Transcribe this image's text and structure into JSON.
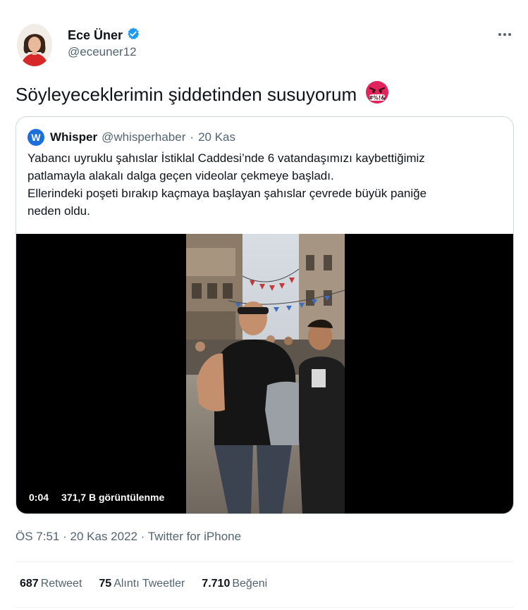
{
  "author": {
    "name": "Ece Üner",
    "handle": "@eceuner12",
    "verified": true
  },
  "tweet": {
    "text": "Söyleyeceklerimin şiddetinden susuyorum",
    "emoji": "#%!&"
  },
  "quoted": {
    "name": "Whisper",
    "handle": "@whisperhaber",
    "separator": "·",
    "date": "20 Kas",
    "logo_letter": "W",
    "body": [
      "Yabancı uyruklu şahıslar İstiklal Caddesi’nde 6 vatandaşımızı kaybettiğimiz",
      "patlamayla alakalı dalga geçen videolar çekmeye başladı.",
      "Ellerindeki poşeti bırakıp kaçmaya başlayan şahıslar çevrede büyük paniğe",
      "neden oldu."
    ],
    "video": {
      "duration": "0:04",
      "views": "371,7 B görüntülenme"
    }
  },
  "meta": {
    "time": "ÖS 7:51",
    "date": "20 Kas 2022",
    "source": "Twitter for iPhone",
    "separator": "·"
  },
  "stats": {
    "retweets": {
      "count": "687",
      "label": "Retweet"
    },
    "quotes": {
      "count": "75",
      "label": "Alıntı Tweetler"
    },
    "likes": {
      "count": "7.710",
      "label": "Beğeni"
    }
  },
  "colors": {
    "verified": "#1d9bf0",
    "secondary_text": "#536471",
    "border": "#cfd9de",
    "angry_emoji": "#e0245e"
  },
  "icons": [
    "verified-badge-icon",
    "more-options-icon",
    "angry-face-icon",
    "whisper-logo-icon"
  ]
}
